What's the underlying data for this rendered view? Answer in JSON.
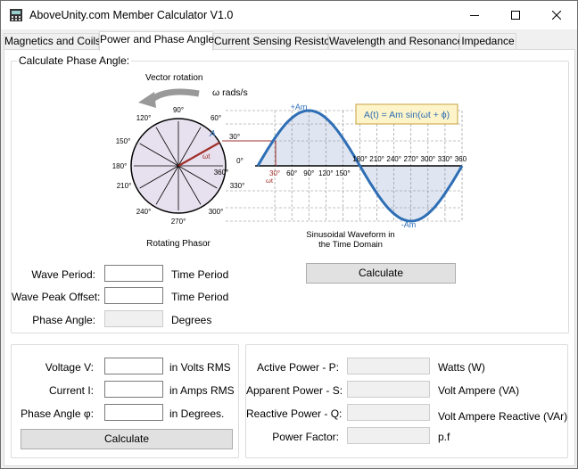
{
  "window": {
    "title": "AboveUnity.com Member Calculator V1.0"
  },
  "tabs": [
    {
      "label": "Magnetics and Coils"
    },
    {
      "label": "Power and Phase Angle"
    },
    {
      "label": "Current Sensing Resistor"
    },
    {
      "label": "Wavelength and Resonance"
    },
    {
      "label": "Impedance"
    }
  ],
  "phase_group": {
    "label": "Calculate Phase Angle:",
    "diagram": {
      "vector_rotation": "Vector rotation",
      "omega_label": "ω rads/s",
      "rotating_phasor": "Rotating Phasor",
      "waveform_caption_line1": "Sinusoidal Waveform in",
      "waveform_caption_line2": "the Time Domain",
      "formula": "A(t) = Am sin(ωt + ϕ)",
      "plus_am": "+Am",
      "minus_am": "-Am",
      "a_label": "A",
      "wt_label": "ωt",
      "angles": [
        "0°",
        "30°",
        "60°",
        "90°",
        "120°",
        "150°",
        "180°",
        "210°",
        "240°",
        "270°",
        "300°",
        "330°",
        "360°"
      ],
      "time_ticks": [
        "30°",
        "60°",
        "90°",
        "120°",
        "150°",
        "180°",
        "210°",
        "240°",
        "270°",
        "300°",
        "330°",
        "360°"
      ]
    },
    "wave_period_label": "Wave Period:",
    "wave_period_value": "",
    "wave_period_unit": "Time Period",
    "peak_offset_label": "Wave Peak Offset:",
    "peak_offset_value": "",
    "peak_offset_unit": "Time Period",
    "phase_angle_label": "Phase Angle:",
    "phase_angle_value": "",
    "phase_angle_unit": "Degrees",
    "calculate_label": "Calculate"
  },
  "power_inputs": {
    "voltage_label": "Voltage V:",
    "voltage_value": "",
    "voltage_unit": "in Volts RMS",
    "current_label": "Current I:",
    "current_value": "",
    "current_unit": "in Amps RMS",
    "phase_label": "Phase Angle φ:",
    "phase_value": "",
    "phase_unit": "in Degrees.",
    "calculate_label": "Calculate"
  },
  "power_outputs": {
    "active_label": "Active Power - P:",
    "active_unit": "Watts (W)",
    "apparent_label": "Apparent Power - S:",
    "apparent_unit": "Volt Ampere (VA)",
    "reactive_label": "Reactive Power - Q:",
    "reactive_unit": "Volt Ampere Reactive (VAr)",
    "pf_label": "Power Factor:",
    "pf_unit": "p.f"
  },
  "colors": {
    "wave": "#2e6eb5",
    "phasor": "#a0302a",
    "fill": "#dfe6f2",
    "circle_fill": "#e7e0ee",
    "formula_bg": "#fdf5c9",
    "formula_border": "#c8a040"
  }
}
